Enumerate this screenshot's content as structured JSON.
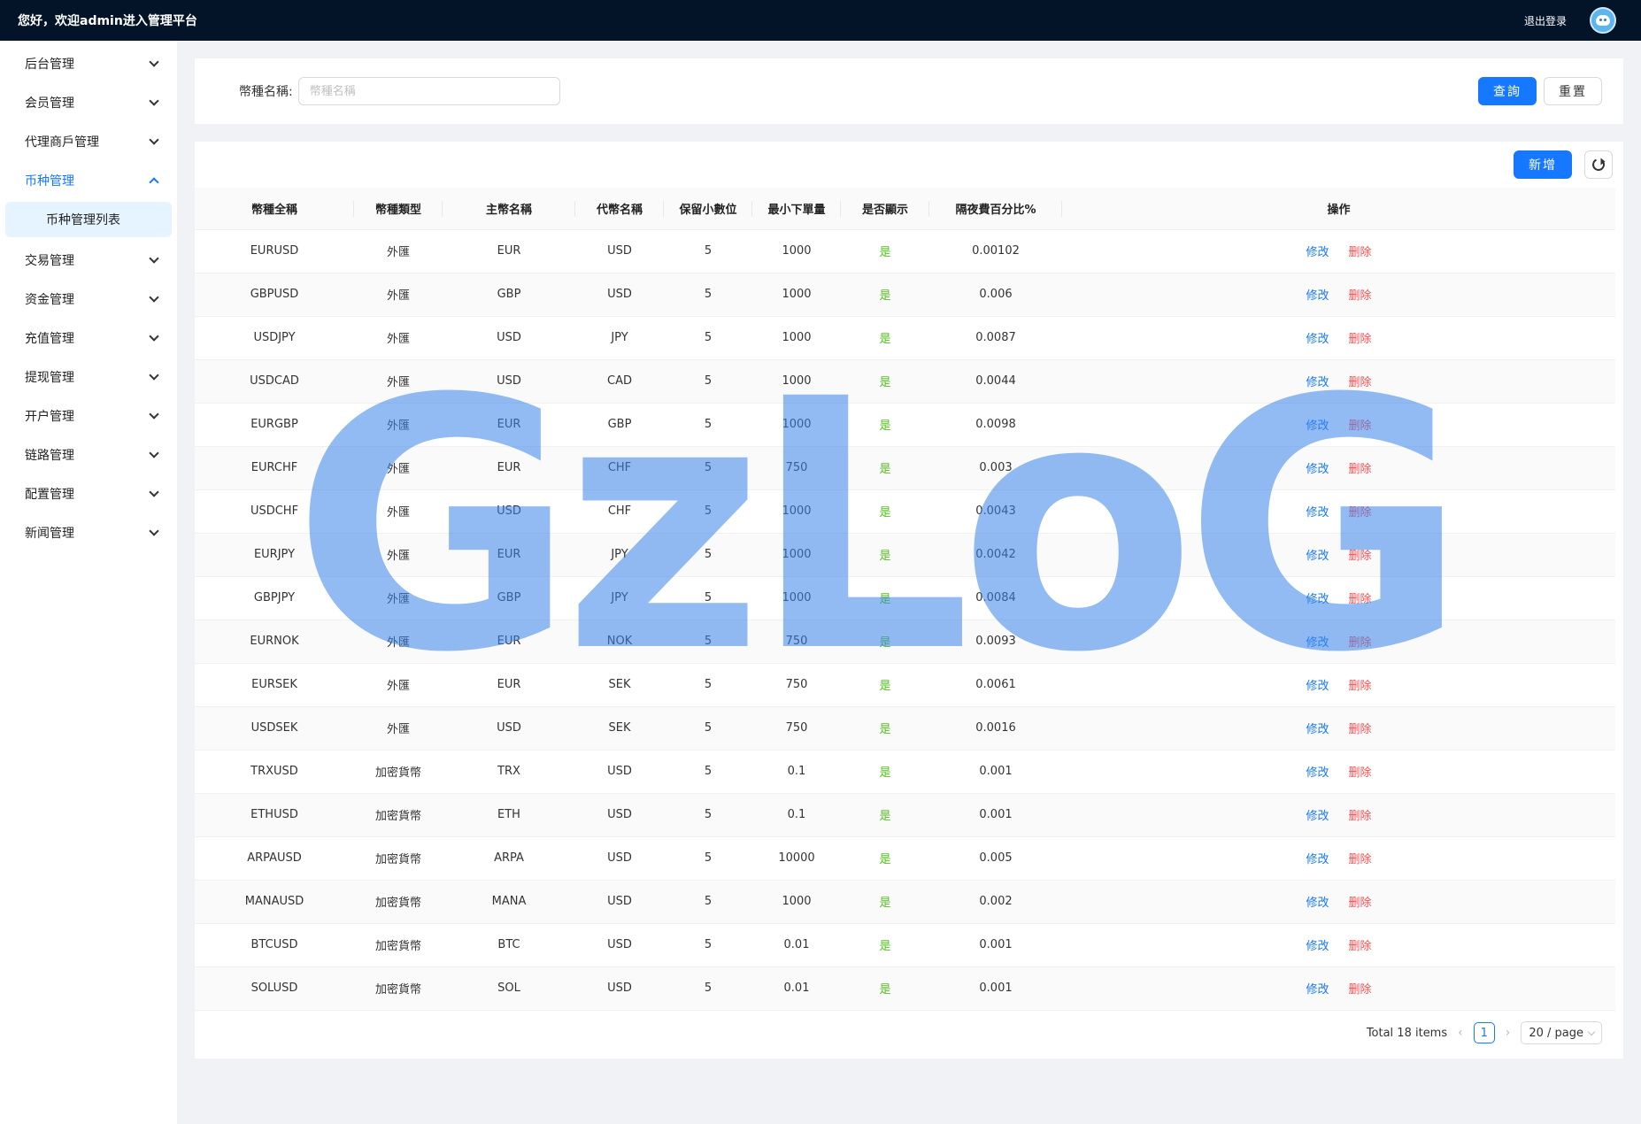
{
  "topbar": {
    "greeting": "您好，欢迎admin进入管理平台",
    "logout": "退出登录"
  },
  "sidebar": {
    "items": [
      {
        "label": "后台管理"
      },
      {
        "label": "会员管理"
      },
      {
        "label": "代理商戶管理"
      },
      {
        "label": "币种管理"
      },
      {
        "label": "交易管理"
      },
      {
        "label": "资金管理"
      },
      {
        "label": "充值管理"
      },
      {
        "label": "提现管理"
      },
      {
        "label": "开户管理"
      },
      {
        "label": "链路管理"
      },
      {
        "label": "配置管理"
      },
      {
        "label": "新闻管理"
      }
    ],
    "submenu": {
      "label": "币种管理列表"
    }
  },
  "search": {
    "label": "幣種名稱:",
    "placeholder": "幣種名稱",
    "query_label": "查詢",
    "reset_label": "重置"
  },
  "toolbar": {
    "add_label": "新增"
  },
  "table": {
    "headers": [
      "幣種全稱",
      "幣種類型",
      "主幣名稱",
      "代幣名稱",
      "保留小數位",
      "最小下單量",
      "是否顯示",
      "隔夜費百分比%",
      "操作"
    ],
    "edit_label": "修改",
    "delete_label": "删除",
    "rows": [
      [
        "EURUSD",
        "外匯",
        "EUR",
        "USD",
        "5",
        "1000",
        "是",
        "0.00102"
      ],
      [
        "GBPUSD",
        "外匯",
        "GBP",
        "USD",
        "5",
        "1000",
        "是",
        "0.006"
      ],
      [
        "USDJPY",
        "外匯",
        "USD",
        "JPY",
        "5",
        "1000",
        "是",
        "0.0087"
      ],
      [
        "USDCAD",
        "外匯",
        "USD",
        "CAD",
        "5",
        "1000",
        "是",
        "0.0044"
      ],
      [
        "EURGBP",
        "外匯",
        "EUR",
        "GBP",
        "5",
        "1000",
        "是",
        "0.0098"
      ],
      [
        "EURCHF",
        "外匯",
        "EUR",
        "CHF",
        "5",
        "750",
        "是",
        "0.003"
      ],
      [
        "USDCHF",
        "外匯",
        "USD",
        "CHF",
        "5",
        "1000",
        "是",
        "0.0043"
      ],
      [
        "EURJPY",
        "外匯",
        "EUR",
        "JPY",
        "5",
        "1000",
        "是",
        "0.0042"
      ],
      [
        "GBPJPY",
        "外匯",
        "GBP",
        "JPY",
        "5",
        "1000",
        "是",
        "0.0084"
      ],
      [
        "EURNOK",
        "外匯",
        "EUR",
        "NOK",
        "5",
        "750",
        "是",
        "0.0093"
      ],
      [
        "EURSEK",
        "外匯",
        "EUR",
        "SEK",
        "5",
        "750",
        "是",
        "0.0061"
      ],
      [
        "USDSEK",
        "外匯",
        "USD",
        "SEK",
        "5",
        "750",
        "是",
        "0.0016"
      ],
      [
        "TRXUSD",
        "加密貨幣",
        "TRX",
        "USD",
        "5",
        "0.1",
        "是",
        "0.001"
      ],
      [
        "ETHUSD",
        "加密貨幣",
        "ETH",
        "USD",
        "5",
        "0.1",
        "是",
        "0.001"
      ],
      [
        "ARPAUSD",
        "加密貨幣",
        "ARPA",
        "USD",
        "5",
        "10000",
        "是",
        "0.005"
      ],
      [
        "MANAUSD",
        "加密貨幣",
        "MANA",
        "USD",
        "5",
        "1000",
        "是",
        "0.002"
      ],
      [
        "BTCUSD",
        "加密貨幣",
        "BTC",
        "USD",
        "5",
        "0.01",
        "是",
        "0.001"
      ],
      [
        "SOLUSD",
        "加密貨幣",
        "SOL",
        "USD",
        "5",
        "0.01",
        "是",
        "0.001"
      ]
    ]
  },
  "pagination": {
    "total": "Total 18 items",
    "current_page": "1",
    "page_size": "20 / page"
  },
  "watermark": {
    "text": "GzLoG"
  },
  "colors": {
    "primary": "#1677ff",
    "danger": "#ff4d4f",
    "success": "#52c41a",
    "topbar": "#031428"
  }
}
